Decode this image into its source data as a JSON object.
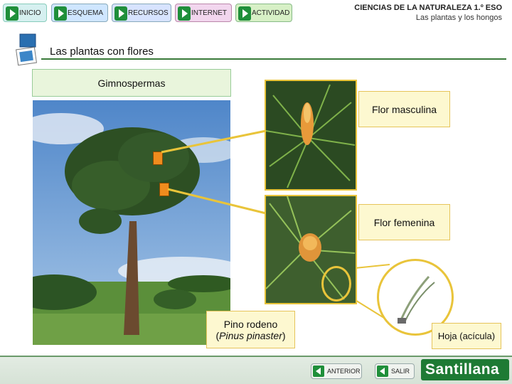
{
  "nav": {
    "items": [
      {
        "label": "INICIO",
        "color": "#d6f0f0"
      },
      {
        "label": "ESQUEMA",
        "color": "#cfe6ff"
      },
      {
        "label": "RECURSOS",
        "color": "#d7e3ff"
      },
      {
        "label": "INTERNET",
        "color": "#f2d6ee"
      },
      {
        "label": "ACTIVIDAD",
        "color": "#d7f0c6"
      }
    ]
  },
  "header": {
    "title": "CIENCIAS DE LA NATURALEZA 1.º ESO",
    "subtitle": "Las plantas y los hongos"
  },
  "section": {
    "title": "Las plantas con flores"
  },
  "labels": {
    "group": "Gimnospermas",
    "male_flower": "Flor masculina",
    "female_flower": "Flor femenina",
    "tree_name_line1": "Pino rodeno",
    "tree_name_open": "(",
    "tree_name_latin": "Pinus pinaster",
    "tree_name_close": ")",
    "leaf": "Hoja (acícula)"
  },
  "footer": {
    "prev_label": "ANTERIOR",
    "exit_label": "SALIR",
    "brand": "Santillana"
  },
  "colors": {
    "accent_green": "#2e7d32",
    "label_bg": "#fdf8d0",
    "label_border": "#e6c45a",
    "connector": "#e9c43a"
  }
}
